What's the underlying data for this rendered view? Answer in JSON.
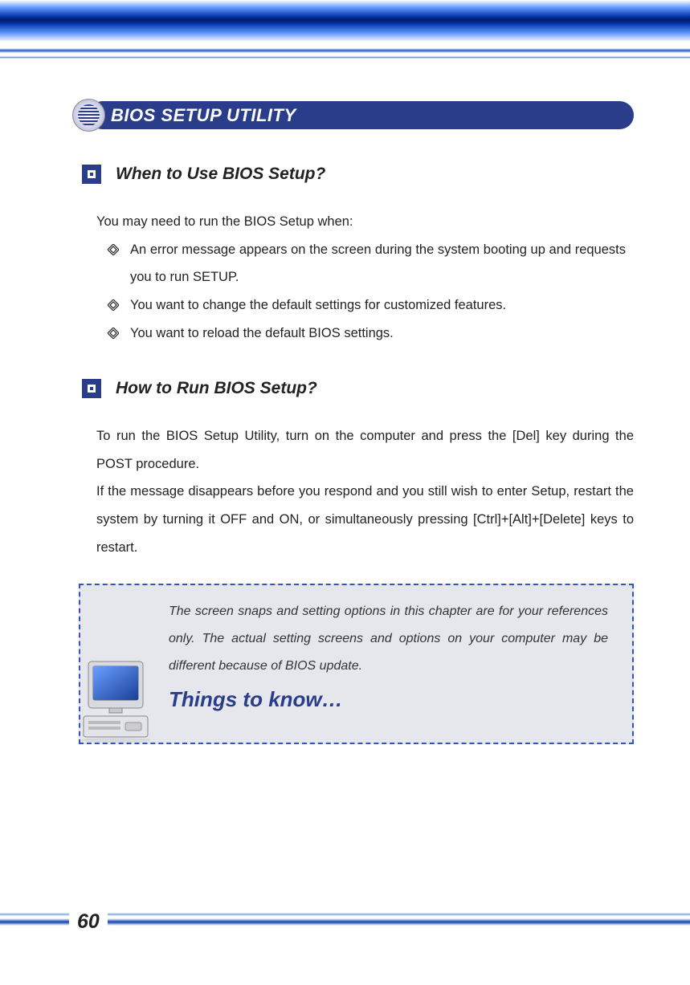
{
  "page_number": "60",
  "main_title": "BIOS SETUP UTILITY",
  "sections": [
    {
      "heading": "When to Use BIOS Setup?",
      "intro": "You may need to run the BIOS Setup when:",
      "bullets": [
        "An error message appears on the screen during the system booting up and requests you to run SETUP.",
        "You want to change the default settings for customized features.",
        "You want to reload the default BIOS settings."
      ]
    },
    {
      "heading": "How to Run BIOS Setup?",
      "paragraphs": [
        "To run the BIOS Setup Utility, turn on the computer and press the [Del] key during the POST procedure.",
        "If the message disappears before you respond and you still wish to enter Setup, restart the system by turning it OFF and ON, or simultaneously pressing [Ctrl]+[Alt]+[Delete] keys to restart."
      ]
    }
  ],
  "info_box": {
    "text": "The screen snaps and setting options in this chapter are for your references only.  The actual setting screens and options on your computer may be different because of BIOS update.",
    "title": "Things to know…"
  }
}
